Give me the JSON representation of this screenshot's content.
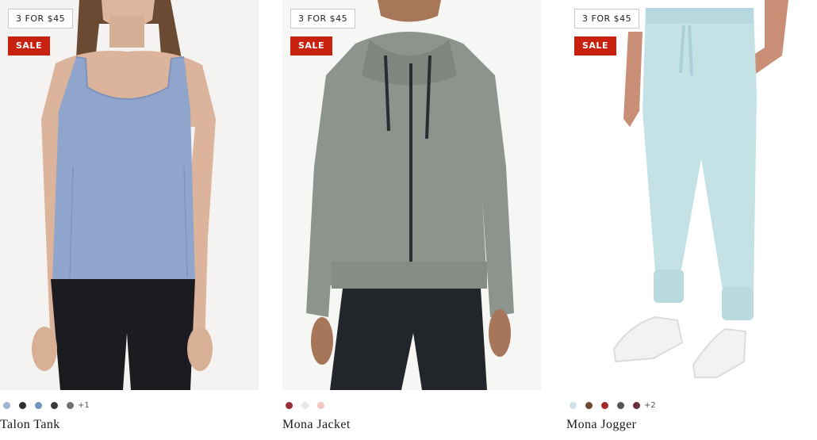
{
  "products": [
    {
      "name": "Talon Tank",
      "promo_badge": "3 FOR $45",
      "sale_badge": "SALE",
      "image_label": "woman wearing periwinkle tank top and black leggings",
      "swatches": [
        "#9fb2d4",
        "#2f2f33",
        "#6f95be",
        "#3a3a3e",
        "#6f7074"
      ],
      "more_colors": "+1",
      "colors": {
        "garment": "#8fa5cc",
        "skin": "#d9b39a",
        "bottom": "#1c1c20"
      }
    },
    {
      "name": "Mona Jacket",
      "promo_badge": "3 FOR $45",
      "sale_badge": "SALE",
      "image_label": "woman wearing heather grey zip-up hooded jacket",
      "swatches": [
        "#9a2d33",
        "#e9e6e4",
        "#f1c8c0"
      ],
      "more_colors": "",
      "colors": {
        "garment": "#8d938d",
        "skin": "#a9785a",
        "bottom": "#22252a"
      }
    },
    {
      "name": "Mona Jogger",
      "promo_badge": "3 FOR $45",
      "sale_badge": "SALE",
      "image_label": "light blue jogger pants with white sneakers",
      "swatches": [
        "#cfe3e6",
        "#6a4a34",
        "#a52a2a",
        "#555258",
        "#6b2e3e"
      ],
      "more_colors": "+2",
      "colors": {
        "garment": "#c4e1e6",
        "skin": "#c98f76",
        "bottom": "#f2f2f2"
      }
    }
  ]
}
